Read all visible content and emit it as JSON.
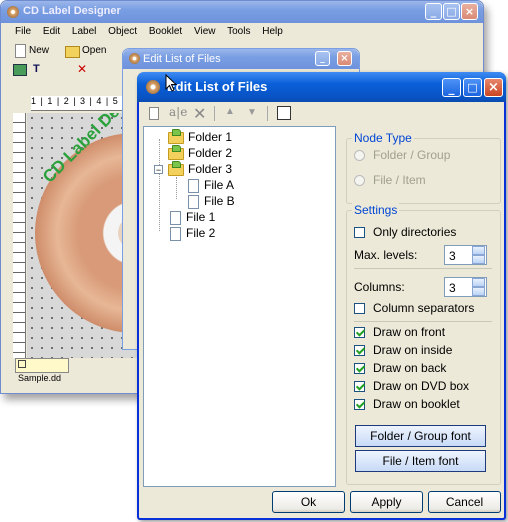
{
  "bg_window": {
    "title": "CD Label Designer",
    "menu": [
      "File",
      "Edit",
      "Label",
      "Object",
      "Booklet",
      "View",
      "Tools",
      "Help"
    ],
    "toolbar": {
      "new_label": "New",
      "open_label": "Open"
    },
    "canvas_text": "CD Label Demo",
    "ruler_numbers": "1 | 1 | 2 | 3 | 4 | 5",
    "sheet_tab": "Sample.dd"
  },
  "mid_window": {
    "title": "Edit List of Files"
  },
  "dialog": {
    "title": "Edit List of Files",
    "toolbar_icons": [
      "new-item-icon",
      "rename-icon",
      "delete-icon",
      "move-up-icon",
      "move-down-icon",
      "properties-icon"
    ],
    "tree": [
      {
        "label": "Folder 1",
        "type": "folder"
      },
      {
        "label": "Folder 2",
        "type": "folder"
      },
      {
        "label": "Folder 3",
        "type": "folder",
        "expander": "−"
      },
      {
        "label": "File A",
        "type": "file"
      },
      {
        "label": "File B",
        "type": "file"
      },
      {
        "label": "File 1",
        "type": "file"
      },
      {
        "label": "File 2",
        "type": "file"
      }
    ],
    "node_type": {
      "legend": "Node Type",
      "options": [
        "Folder / Group",
        "File / Item"
      ]
    },
    "settings": {
      "legend": "Settings",
      "only_directories": "Only directories",
      "max_levels_label": "Max. levels:",
      "max_levels_value": "3",
      "columns_label": "Columns:",
      "columns_value": "3",
      "column_separators": "Column separators",
      "draw_front": "Draw on front",
      "draw_inside": "Draw on inside",
      "draw_back": "Draw on back",
      "draw_dvd": "Draw on DVD box",
      "draw_booklet": "Draw on booklet",
      "folder_font_btn": "Folder / Group font",
      "file_font_btn": "File / Item font"
    },
    "buttons": {
      "ok": "Ok",
      "apply": "Apply",
      "cancel": "Cancel"
    }
  }
}
